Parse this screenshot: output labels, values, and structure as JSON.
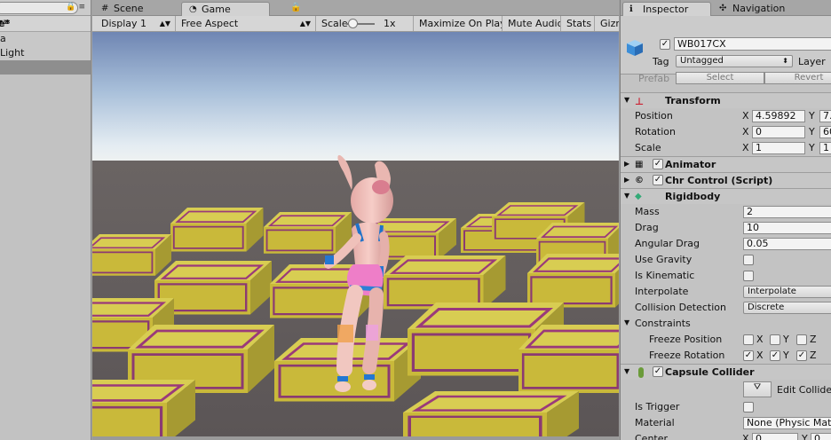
{
  "hierarchy": {
    "scene_name": "e*",
    "items": [
      "a",
      "Light"
    ],
    "selected_index": 2
  },
  "tabs": {
    "scene": "Scene",
    "game": "Game"
  },
  "game_toolbar": {
    "display": "Display 1",
    "aspect": "Free Aspect",
    "scale_label": "Scale",
    "scale_value": "1x",
    "maximize": "Maximize On Play",
    "mute": "Mute Audio",
    "stats": "Stats",
    "gizmos": "Gizm"
  },
  "inspector": {
    "tab_inspector": "Inspector",
    "tab_navigation": "Navigation",
    "object_name": "WB017CX",
    "tag_label": "Tag",
    "tag_value": "Untagged",
    "layer_label": "Layer",
    "prefab_label": "Prefab",
    "prefab_select": "Select",
    "prefab_revert": "Revert",
    "transform": {
      "title": "Transform",
      "position_label": "Position",
      "rotation_label": "Rotation",
      "scale_label": "Scale",
      "position": {
        "x": "4.59892",
        "y": "7."
      },
      "rotation": {
        "x": "0",
        "y": "60"
      },
      "scale": {
        "x": "1",
        "y": "1"
      }
    },
    "animator_title": "Animator",
    "chr_control_title": "Chr Control (Script)",
    "rigidbody": {
      "title": "Rigidbody",
      "mass_label": "Mass",
      "mass": "2",
      "drag_label": "Drag",
      "drag": "10",
      "angular_drag_label": "Angular Drag",
      "angular_drag": "0.05",
      "use_gravity_label": "Use Gravity",
      "is_kinematic_label": "Is Kinematic",
      "interpolate_label": "Interpolate",
      "interpolate": "Interpolate",
      "collision_label": "Collision Detection",
      "collision": "Discrete",
      "constraints_label": "Constraints",
      "freeze_position_label": "Freeze Position",
      "freeze_rotation_label": "Freeze Rotation",
      "x": "X",
      "y": "Y",
      "z": "Z"
    },
    "capsule": {
      "title": "Capsule Collider",
      "edit_label": "Edit Collide",
      "is_trigger_label": "Is Trigger",
      "material_label": "Material",
      "material": "None (Physic Mat",
      "center_label": "Center",
      "center_x": "0",
      "center_y": "0."
    },
    "axis_x": "X",
    "axis_y": "Y"
  }
}
